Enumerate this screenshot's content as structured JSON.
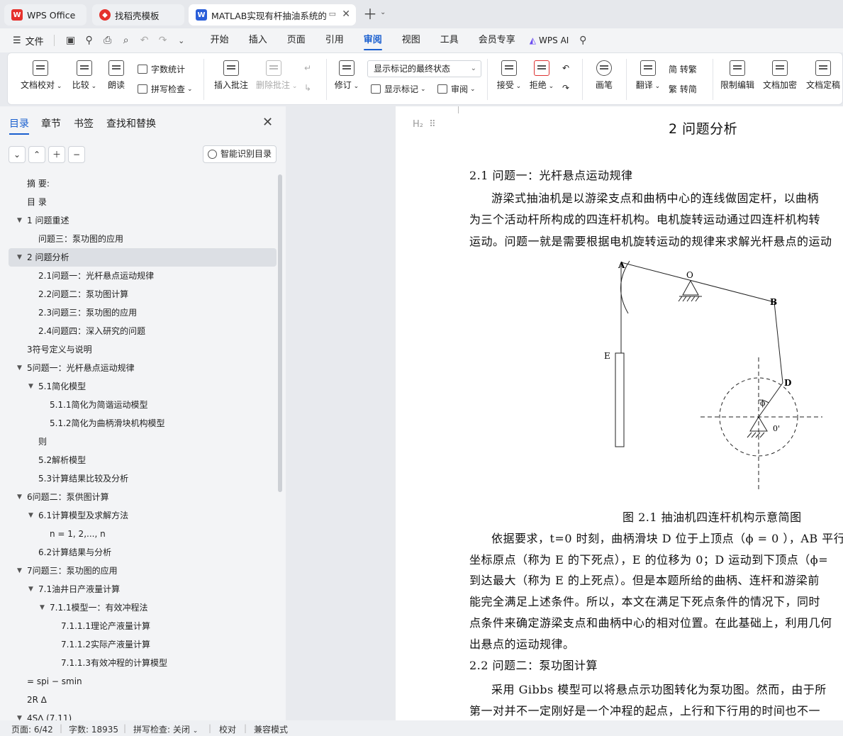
{
  "tabs": [
    {
      "label": "WPS Office",
      "icon": "wps-logo-icon"
    },
    {
      "label": "找稻壳模板",
      "icon": "docer-logo-icon"
    },
    {
      "label": "MATLAB实现有杆抽油系统的",
      "icon": "word-doc-icon"
    }
  ],
  "menu": {
    "file": "文件",
    "items": [
      "开始",
      "插入",
      "页面",
      "引用",
      "审阅",
      "视图",
      "工具",
      "会员专享"
    ],
    "active": "审阅",
    "wps_ai": "WPS AI"
  },
  "ribbon": {
    "doc_check": "文档校对",
    "compare": "比较",
    "read_aloud": "朗读",
    "word_count": "字数统计",
    "spell_check": "拼写检查",
    "insert_comment": "插入批注",
    "delete_comment": "删除批注",
    "revise": "修订",
    "mark_state": "显示标记的最终状态",
    "show_marks": "显示标记",
    "review": "审阅",
    "accept": "接受",
    "reject": "拒绝",
    "pen": "画笔",
    "translate": "翻译",
    "to_traditional": "简 转繁",
    "to_simplified": "繁 转简",
    "restrict_edit": "限制编辑",
    "encrypt": "文档加密",
    "finalize": "文档定稿"
  },
  "sidebar": {
    "tabs": [
      "目录",
      "章节",
      "书签",
      "查找和替换"
    ],
    "smart_toc": "智能识别目录",
    "toc": [
      {
        "label": "摘  要:",
        "level": 1,
        "caret": ""
      },
      {
        "label": "目  录",
        "level": 1,
        "caret": ""
      },
      {
        "label": "1 问题重述",
        "level": 1,
        "caret": "▼"
      },
      {
        "label": "问题三：泵功图的应用",
        "level": 2,
        "caret": ""
      },
      {
        "label": "2 问题分析",
        "level": 1,
        "caret": "▼",
        "selected": true
      },
      {
        "label": "2.1问题一：光杆悬点运动规律",
        "level": 2,
        "caret": ""
      },
      {
        "label": "2.2问题二：泵功图计算",
        "level": 2,
        "caret": ""
      },
      {
        "label": "2.3问题三：泵功图的应用",
        "level": 2,
        "caret": ""
      },
      {
        "label": "2.4问题四：深入研究的问题",
        "level": 2,
        "caret": ""
      },
      {
        "label": "3符号定义与说明",
        "level": 1,
        "caret": ""
      },
      {
        "label": "5问题一：光杆悬点运动规律",
        "level": 1,
        "caret": "▼"
      },
      {
        "label": "5.1简化模型",
        "level": 2,
        "caret": "▼"
      },
      {
        "label": "5.1.1简化为简谐运动模型",
        "level": 3,
        "caret": ""
      },
      {
        "label": "5.1.2简化为曲柄滑块机构模型",
        "level": 3,
        "caret": ""
      },
      {
        "label": "则",
        "level": 2,
        "caret": ""
      },
      {
        "label": "5.2解析模型",
        "level": 2,
        "caret": ""
      },
      {
        "label": "5.3计算结果比较及分析",
        "level": 2,
        "caret": ""
      },
      {
        "label": "6问题二：泵供图计算",
        "level": 1,
        "caret": "▼"
      },
      {
        "label": "6.1计算模型及求解方法",
        "level": 2,
        "caret": "▼"
      },
      {
        "label": "n = 1, 2,..., n",
        "level": 3,
        "caret": ""
      },
      {
        "label": "6.2计算结果与分析",
        "level": 2,
        "caret": ""
      },
      {
        "label": "7问题三：泵功图的应用",
        "level": 1,
        "caret": "▼"
      },
      {
        "label": "7.1油井日产液量计算",
        "level": 2,
        "caret": "▼"
      },
      {
        "label": "7.1.1模型一：有效冲程法",
        "level": 3,
        "caret": "▼"
      },
      {
        "label": "7.1.1.1理论产液量计算",
        "level": 4,
        "caret": ""
      },
      {
        "label": "7.1.1.2实际产液量计算",
        "level": 4,
        "caret": ""
      },
      {
        "label": "7.1.1.3有效冲程的计算模型",
        "level": 4,
        "caret": ""
      },
      {
        "label": "= spi − smin",
        "level": 1,
        "caret": ""
      },
      {
        "label": "2R ∆",
        "level": 1,
        "caret": ""
      },
      {
        "label": "4S∆ (7.11)",
        "level": 1,
        "caret": "▼"
      }
    ]
  },
  "document": {
    "heading_marker": "H₂",
    "chapter_title": "2  问题分析",
    "sec21": "2.1   问题一：光杆悬点运动规律",
    "para1": [
      "游梁式抽油机是以游梁支点和曲柄中心的连线做固定杆，以曲柄",
      "为三个活动杆所构成的四连杆机构。电机旋转运动通过四连杆机构转",
      "运动。问题一就是需要根据电机旋转运动的规律来求解光杆悬点的运动"
    ],
    "figure_labels": {
      "A": "A",
      "O": "O",
      "B": "B",
      "E": "E",
      "D": "D",
      "phi": "ϕ",
      "O2": "0'"
    },
    "figure_caption": "图  2.1 抽油机四连杆机构示意简图",
    "para2": [
      "依据要求，t=0 时刻，曲柄滑块 D 位于上顶点（ϕ = 0 ），AB 平行",
      "坐标原点（称为 E 的下死点），E 的位移为 0；D 运动到下顶点（ϕ=",
      "到达最大（称为 E 的上死点）。但是本题所给的曲柄、连杆和游梁前",
      "能完全满足上述条件。所以，本文在满足下死点条件的情况下，同时",
      "点条件来确定游梁支点和曲柄中心的相对位置。在此基础上，利用几何",
      "出悬点的运动规律。"
    ],
    "sec22": "2.2   问题二：泵功图计算",
    "para3": [
      "采用 Gibbs 模型可以将悬点示功图转化为泵功图。然而，由于所",
      "第一对并不一定刚好是一个冲程的起点，上行和下行用的时间也不一"
    ]
  },
  "status": {
    "page": "页面: 6/42",
    "words": "字数: 18935",
    "spell": "拼写检查: 关闭",
    "proof": "校对",
    "compat": "兼容模式"
  },
  "colors": {
    "accent": "#1a5fcf",
    "wps_red": "#e5312c",
    "word_blue": "#2b5fd9"
  }
}
